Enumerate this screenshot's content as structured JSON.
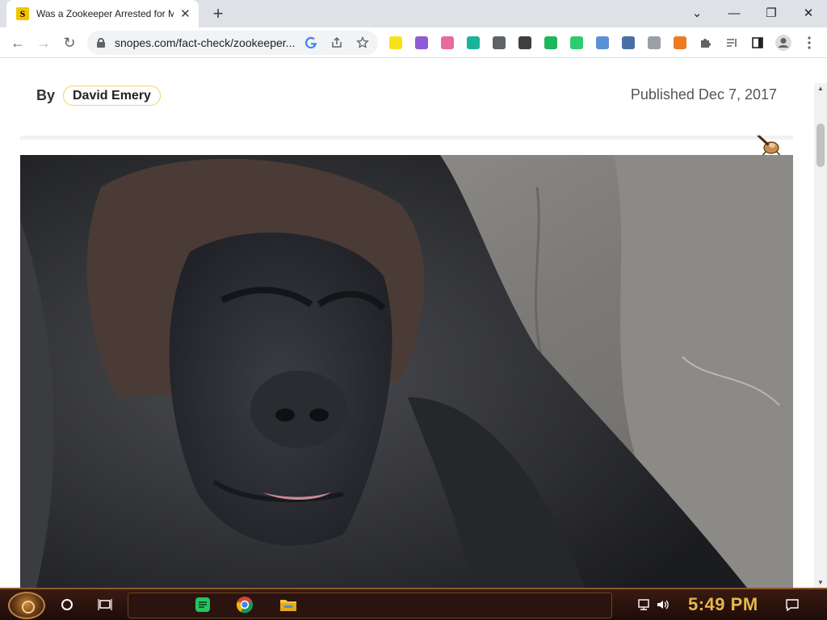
{
  "browser": {
    "tab": {
      "title": "Was a Zookeeper Arrested for M",
      "favicon": "S",
      "close_glyph": "✕"
    },
    "new_tab_glyph": "+",
    "window_controls": {
      "minimize": "—",
      "restore": "❐",
      "close": "✕",
      "tab_search": "⌄"
    },
    "omnibox": {
      "url": "snopes.com/fact-check/zookeeper..."
    },
    "nav": {
      "back": "←",
      "forward": "→",
      "reload": "↻"
    },
    "extensions": [
      {
        "name": "extension-yellow",
        "color": "#f9e11a"
      },
      {
        "name": "extension-purple",
        "color": "#8e5bd6"
      },
      {
        "name": "extension-pink",
        "color": "#e86aa3"
      },
      {
        "name": "extension-teal-circle",
        "color": "#19b39a"
      },
      {
        "name": "extension-grey-circle",
        "color": "#5f6368"
      },
      {
        "name": "extension-chat",
        "color": "#3c4043"
      },
      {
        "name": "extension-green-video",
        "color": "#1fb55a"
      },
      {
        "name": "extension-green-square",
        "color": "#2ecc71"
      },
      {
        "name": "extension-grid",
        "color": "#5b8fd6"
      },
      {
        "name": "extension-castle",
        "color": "#4a6fa5"
      },
      {
        "name": "extension-s",
        "color": "#9aa0a6"
      },
      {
        "name": "extension-orange",
        "color": "#f07a1e"
      }
    ]
  },
  "article": {
    "by_label": "By",
    "author": "David Emery",
    "published": "Published Dec 7, 2017"
  },
  "taskbar": {
    "clock": "5:49 PM"
  }
}
